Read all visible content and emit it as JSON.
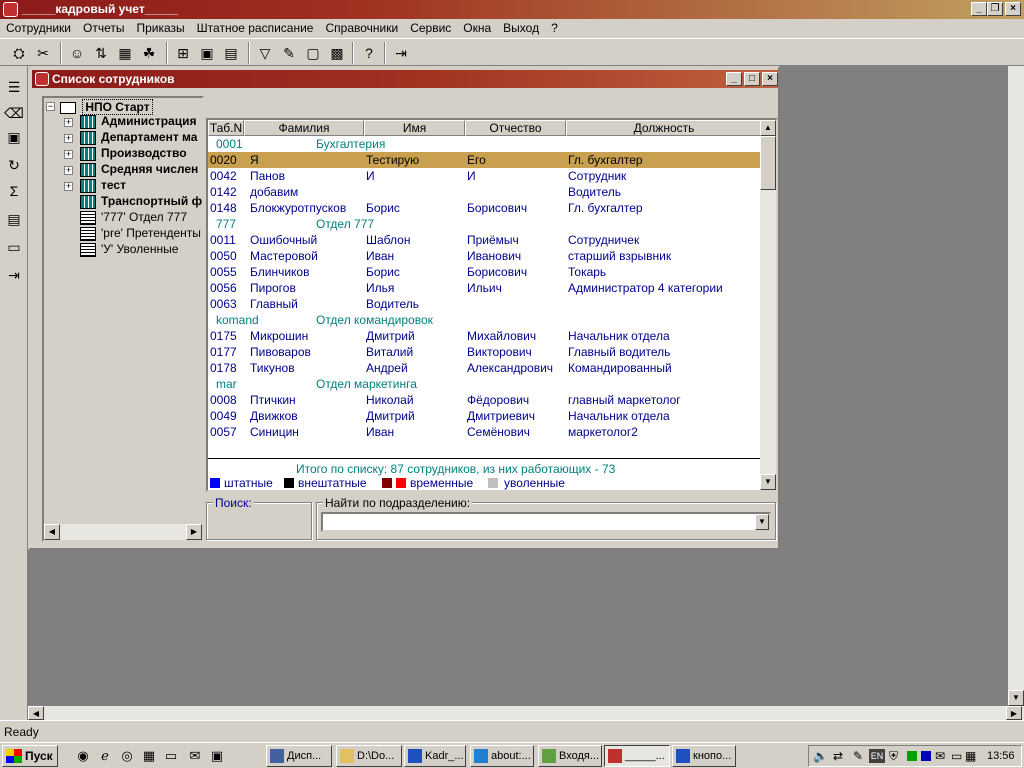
{
  "app": {
    "title": "_____кадровый учет_____"
  },
  "menu": [
    "Сотрудники",
    "Отчеты",
    "Приказы",
    "Штатное расписание",
    "Справочники",
    "Сервис",
    "Окна",
    "Выход",
    "?"
  ],
  "window": {
    "title": "Список сотрудников",
    "tree": {
      "root": "НПО Старт",
      "items": [
        {
          "label": "Администрация",
          "bold": true,
          "expandable": true
        },
        {
          "label": "Департамент ма",
          "bold": true,
          "expandable": true
        },
        {
          "label": "Производство",
          "bold": true,
          "expandable": true
        },
        {
          "label": "Средняя числен",
          "bold": true,
          "expandable": true
        },
        {
          "label": "тест",
          "bold": true,
          "expandable": true
        },
        {
          "label": "Транспортный ф",
          "bold": true,
          "expandable": false
        },
        {
          "label": "'777' Отдел 777",
          "bold": false,
          "expandable": false
        },
        {
          "label": "'pre' Претенденты",
          "bold": false,
          "expandable": false
        },
        {
          "label": "'У' Уволенные",
          "bold": false,
          "expandable": false
        }
      ]
    },
    "grid": {
      "columns": [
        "Таб.N",
        "Фамилия",
        "Имя",
        "Отчество",
        "Должность"
      ],
      "rows": [
        {
          "type": "group",
          "code": "0001",
          "name": "Бухгалтерия"
        },
        {
          "type": "sel",
          "cells": [
            "0020",
            "Я",
            "Тестирую",
            "Его",
            "Гл. бухгалтер"
          ]
        },
        {
          "type": "data",
          "cells": [
            "0042",
            "Панов",
            "И",
            "И",
            "Сотрудник"
          ]
        },
        {
          "type": "data",
          "cells": [
            "0142",
            "добавим",
            "",
            "",
            "Водитель"
          ]
        },
        {
          "type": "data",
          "cells": [
            "0148",
            "Блокжуротпусков",
            "Борис",
            "Борисович",
            "Гл. бухгалтер"
          ]
        },
        {
          "type": "group",
          "code": "777",
          "name": "Отдел 777"
        },
        {
          "type": "data",
          "cells": [
            "0011",
            "Ошибочный",
            "Шаблон",
            "Приёмыч",
            "Сотрудничек"
          ]
        },
        {
          "type": "data",
          "cells": [
            "0050",
            "Мастеровой",
            "Иван",
            "Иванович",
            "старший взрывник"
          ]
        },
        {
          "type": "data",
          "cells": [
            "0055",
            "Блинчиков",
            "Борис",
            "Борисович",
            "Токарь"
          ]
        },
        {
          "type": "data",
          "cells": [
            "0056",
            "Пирогов",
            "Илья",
            "Ильич",
            "Администратор 4 категории"
          ]
        },
        {
          "type": "data",
          "cells": [
            "0063",
            "Главный",
            "Водитель",
            "",
            ""
          ]
        },
        {
          "type": "group",
          "code": "komand",
          "name": "Отдел командировок"
        },
        {
          "type": "data",
          "cells": [
            "0175",
            "Микрошин",
            "Дмитрий",
            "Михайлович",
            "Начальник отдела"
          ]
        },
        {
          "type": "data",
          "cells": [
            "0177",
            "Пивоваров",
            "Виталий",
            "Викторович",
            "Главный водитель"
          ]
        },
        {
          "type": "data",
          "cells": [
            "0178",
            "Тикунов",
            "Андрей",
            "Александрович",
            "Командированный"
          ]
        },
        {
          "type": "group",
          "code": "mar",
          "name": "Отдел маркетинга"
        },
        {
          "type": "data",
          "cells": [
            "0008",
            "Птичкин",
            "Николай",
            "Фёдорович",
            "главный маркетолог"
          ]
        },
        {
          "type": "data",
          "cells": [
            "0049",
            "Движков",
            "Дмитрий",
            "Дмитриевич",
            "Начальник отдела"
          ]
        },
        {
          "type": "data",
          "cells": [
            "0057",
            "Синицин",
            "Иван",
            "Семёнович",
            "маркетолог2"
          ]
        }
      ],
      "summary": "Итого по списку: 87 сотрудников, из них работающих - 73",
      "legend": [
        {
          "label": "штатные",
          "colors": [
            "#0000ff"
          ]
        },
        {
          "label": "внештатные",
          "colors": [
            "#000000"
          ]
        },
        {
          "label": "временные",
          "colors": [
            "#800000",
            "#ff0000"
          ]
        },
        {
          "label": "уволенные",
          "colors": [
            "#c0c0c0"
          ]
        }
      ]
    },
    "search_label": "Поиск:",
    "dept_search_label": "Найти по подразделению:"
  },
  "status": "Ready",
  "taskbar": {
    "start": "Пуск",
    "tasks": [
      "Дисп...",
      "D:\\Do...",
      "Kadr_...",
      "about:...",
      "Входя...",
      "_____...",
      "кнопо..."
    ],
    "lang": "EN",
    "clock": "13:56"
  }
}
